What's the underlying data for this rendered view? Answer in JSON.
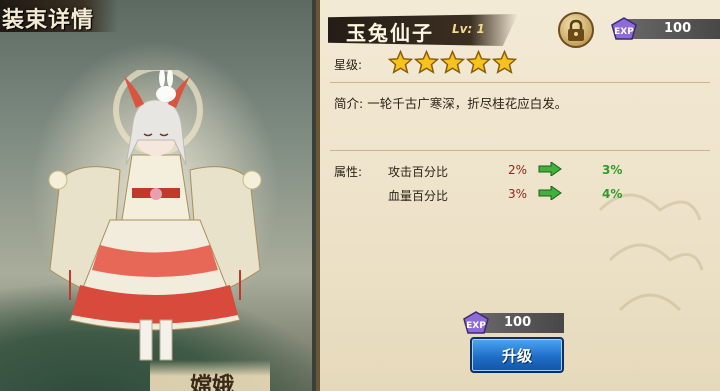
{
  "left_panel": {
    "title": "装束详情",
    "hero_name": "嫦娥"
  },
  "item": {
    "name": "玉兔仙子",
    "level": "Lv: 1",
    "locked": true,
    "exp_cost_top": "100",
    "star_label": "星级:",
    "stars": 5,
    "bio_label": "简介:",
    "bio_text": "一轮千古广寒深，折尽桂花应白发。",
    "attr_label": "属性:",
    "attributes": [
      {
        "name": "攻击百分比",
        "current": "2%",
        "next": "3%"
      },
      {
        "name": "血量百分比",
        "current": "3%",
        "next": "4%"
      }
    ]
  },
  "upgrade": {
    "exp_cost": "100",
    "button_label": "升级"
  },
  "icons": {
    "lock": "lock-icon",
    "exp": "exp-gem-icon",
    "star": "star-icon",
    "arrow": "green-arrow-icon"
  },
  "colors": {
    "parchment": "#f3ead6",
    "arrow_green": "#2e9b2a",
    "button_blue": "#1e6fc9",
    "current_value": "#8a2a1a"
  }
}
